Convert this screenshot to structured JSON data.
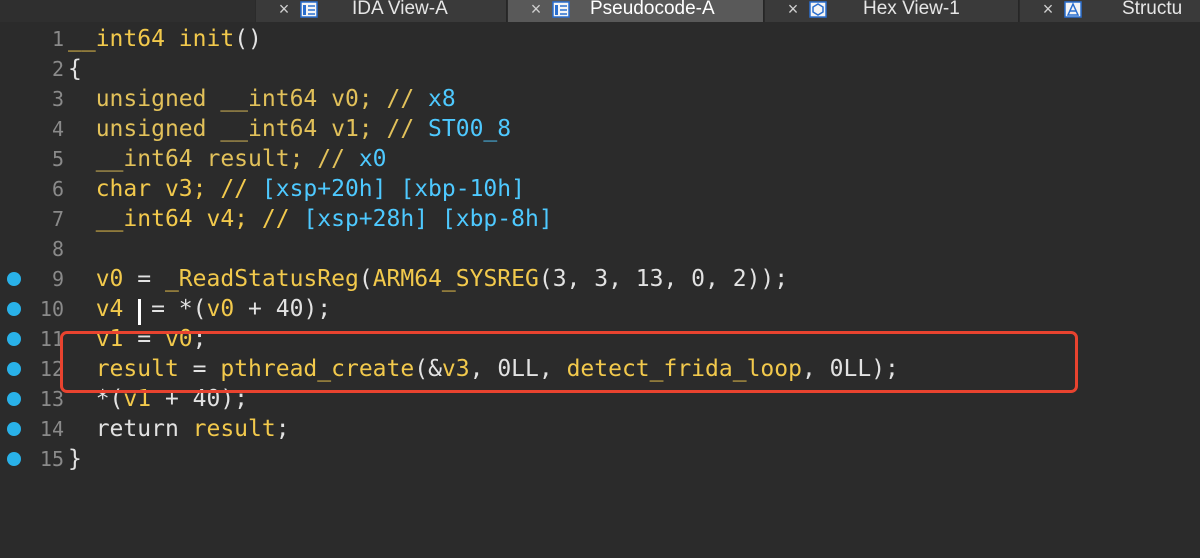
{
  "tabs": [
    {
      "label": "IDA View-A",
      "icon": "disassembly-view-icon",
      "active": false
    },
    {
      "label": "Pseudocode-A",
      "icon": "pseudocode-view-icon",
      "active": true
    },
    {
      "label": "Hex View-1",
      "icon": "hex-view-icon",
      "active": false
    },
    {
      "label": "Structu",
      "icon": "structures-view-icon",
      "active": false
    }
  ],
  "close_glyph": "×",
  "colors": {
    "keyword": "#f2c94c",
    "identifier": "#4ec9ff",
    "plain": "#e2e2e2",
    "breakpoint": "#29b1e8",
    "annotation_box": "#e8432f"
  },
  "code": [
    {
      "num": "1",
      "breakpoint": false,
      "tokens": [
        [
          "kw",
          "__int64"
        ],
        [
          "wh",
          " "
        ],
        [
          "kw",
          "init"
        ],
        [
          "wh",
          "()"
        ]
      ]
    },
    {
      "num": "2",
      "breakpoint": false,
      "tokens": [
        [
          "wh",
          "{"
        ]
      ]
    },
    {
      "num": "3",
      "breakpoint": false,
      "tokens": [
        [
          "wh",
          "  "
        ],
        [
          "ty",
          "unsigned __int64 v0; // "
        ],
        [
          "id",
          "x8"
        ]
      ]
    },
    {
      "num": "4",
      "breakpoint": false,
      "tokens": [
        [
          "wh",
          "  "
        ],
        [
          "ty",
          "unsigned __int64 v1; // "
        ],
        [
          "id",
          "ST00_8"
        ]
      ]
    },
    {
      "num": "5",
      "breakpoint": false,
      "tokens": [
        [
          "wh",
          "  "
        ],
        [
          "ty",
          "__int64 result; // "
        ],
        [
          "id",
          "x0"
        ]
      ]
    },
    {
      "num": "6",
      "breakpoint": false,
      "tokens": [
        [
          "wh",
          "  "
        ],
        [
          "kw",
          "char v3; // "
        ],
        [
          "id",
          "[xsp+20h] [xbp-10h]"
        ]
      ]
    },
    {
      "num": "7",
      "breakpoint": false,
      "tokens": [
        [
          "wh",
          "  "
        ],
        [
          "kw",
          "__int64 v4; // "
        ],
        [
          "id",
          "[xsp+28h] [xbp-8h]"
        ]
      ]
    },
    {
      "num": "8",
      "breakpoint": false,
      "tokens": []
    },
    {
      "num": "9",
      "breakpoint": true,
      "tokens": [
        [
          "wh",
          "  "
        ],
        [
          "kw",
          "v0"
        ],
        [
          "wh",
          " = "
        ],
        [
          "kw",
          "_ReadStatusReg"
        ],
        [
          "wh",
          "("
        ],
        [
          "kw",
          "ARM64_SYSREG"
        ],
        [
          "wh",
          "(3, 3, 13, 0, 2));"
        ]
      ]
    },
    {
      "num": "10",
      "breakpoint": true,
      "tokens": [
        [
          "wh",
          "  "
        ],
        [
          "kw",
          "v4"
        ],
        [
          "wh",
          "  = *("
        ],
        [
          "kw",
          "v0"
        ],
        [
          "wh",
          " + 40);"
        ]
      ]
    },
    {
      "num": "11",
      "breakpoint": true,
      "tokens": [
        [
          "wh",
          "  "
        ],
        [
          "kw",
          "v1"
        ],
        [
          "wh",
          " = "
        ],
        [
          "kw",
          "v0"
        ],
        [
          "wh",
          ";"
        ]
      ]
    },
    {
      "num": "12",
      "breakpoint": true,
      "tokens": [
        [
          "wh",
          "  "
        ],
        [
          "kw",
          "result"
        ],
        [
          "wh",
          " = "
        ],
        [
          "kw",
          "pthread_create"
        ],
        [
          "wh",
          "(&"
        ],
        [
          "kw",
          "v3"
        ],
        [
          "wh",
          ", 0LL, "
        ],
        [
          "kw",
          "detect_frida_loop"
        ],
        [
          "wh",
          ", 0LL);"
        ]
      ]
    },
    {
      "num": "13",
      "breakpoint": true,
      "tokens": [
        [
          "wh",
          "  *("
        ],
        [
          "kw",
          "v1"
        ],
        [
          "wh",
          " + 40);"
        ]
      ]
    },
    {
      "num": "14",
      "breakpoint": true,
      "tokens": [
        [
          "wh",
          "  "
        ],
        [
          "wh",
          "return "
        ],
        [
          "kw",
          "result"
        ],
        [
          "wh",
          ";"
        ]
      ]
    },
    {
      "num": "15",
      "breakpoint": true,
      "tokens": [
        [
          "wh",
          "}"
        ]
      ]
    }
  ]
}
